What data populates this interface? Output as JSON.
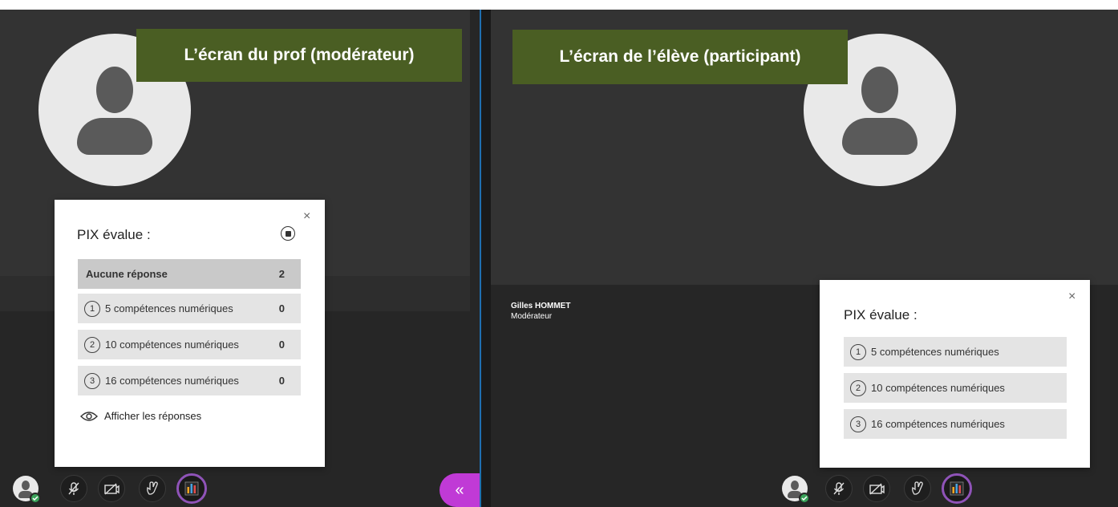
{
  "teacher_banner": "L’écran du prof (modérateur)",
  "student_banner": "L’écran de l’élève (participant)",
  "moderator_panel": {
    "title": "PIX évalue :",
    "close": "×",
    "no_response": {
      "label": "Aucune réponse",
      "count": "2"
    },
    "options": [
      {
        "num": "1",
        "label": "5 compétences numériques",
        "count": "0"
      },
      {
        "num": "2",
        "label": "10 compétences numériques",
        "count": "0"
      },
      {
        "num": "3",
        "label": "16 compétences numériques",
        "count": "0"
      }
    ],
    "show_responses": "Afficher les réponses"
  },
  "participant_panel": {
    "title": "PIX évalue :",
    "close": "×",
    "options": [
      {
        "num": "1",
        "label": "5 compétences numériques"
      },
      {
        "num": "2",
        "label": "10 compétences numériques"
      },
      {
        "num": "3",
        "label": "16 compétences numériques"
      }
    ]
  },
  "presenter": {
    "name": "Gilles HOMMET",
    "role": "Modérateur"
  },
  "collapse_icon": "«",
  "colors": {
    "banner": "#4a5e23",
    "accent": "#c03ad6",
    "poll_ring": "#8f53b8",
    "status_ok": "#3aa35a"
  },
  "icons": [
    "avatar-icon",
    "mic-off-icon",
    "camera-off-icon",
    "raise-hand-icon",
    "poll-icon",
    "double-chevron-left-icon"
  ]
}
